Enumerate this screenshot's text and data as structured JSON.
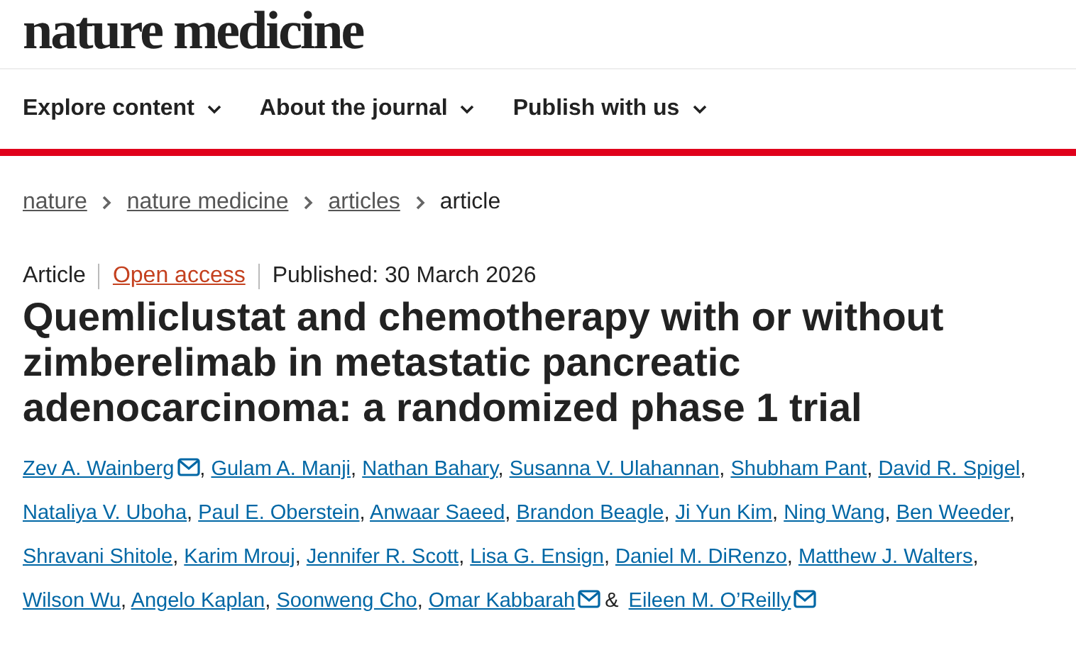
{
  "logo": "nature medicine",
  "nav": [
    {
      "label": "Explore content"
    },
    {
      "label": "About the journal"
    },
    {
      "label": "Publish with us"
    }
  ],
  "breadcrumb": [
    {
      "label": "nature",
      "current": false
    },
    {
      "label": "nature medicine",
      "current": false
    },
    {
      "label": "articles",
      "current": false
    },
    {
      "label": "article",
      "current": true
    }
  ],
  "meta": [
    {
      "text": "Article",
      "kind": "type"
    },
    {
      "text": "Open access",
      "kind": "access"
    },
    {
      "text": "Published: 30 March 2026",
      "kind": "date"
    }
  ],
  "title": "Quemliclustat and chemotherapy with or without zimberelimab in metastatic pancreatic adenocarcinoma: a randomized phase 1 trial",
  "authors": [
    {
      "name": "Zev A. Wainberg",
      "email": true,
      "sep": ","
    },
    {
      "name": "Gulam A. Manji",
      "email": false,
      "sep": ","
    },
    {
      "name": "Nathan Bahary",
      "email": false,
      "sep": ","
    },
    {
      "name": "Susanna V. Ulahannan",
      "email": false,
      "sep": ","
    },
    {
      "name": "Shubham Pant",
      "email": false,
      "sep": ","
    },
    {
      "name": "David R. Spigel",
      "email": false,
      "sep": ","
    },
    {
      "name": "Nataliya V. Uboha",
      "email": false,
      "sep": ","
    },
    {
      "name": "Paul E. Oberstein",
      "email": false,
      "sep": ","
    },
    {
      "name": "Anwaar Saeed",
      "email": false,
      "sep": ","
    },
    {
      "name": "Brandon Beagle",
      "email": false,
      "sep": ","
    },
    {
      "name": "Ji Yun Kim",
      "email": false,
      "sep": ","
    },
    {
      "name": "Ning Wang",
      "email": false,
      "sep": ","
    },
    {
      "name": "Ben Weeder",
      "email": false,
      "sep": ","
    },
    {
      "name": "Shravani Shitole",
      "email": false,
      "sep": ","
    },
    {
      "name": "Karim Mrouj",
      "email": false,
      "sep": ","
    },
    {
      "name": "Jennifer R. Scott",
      "email": false,
      "sep": ","
    },
    {
      "name": "Lisa G. Ensign",
      "email": false,
      "sep": ","
    },
    {
      "name": "Daniel M. DiRenzo",
      "email": false,
      "sep": ","
    },
    {
      "name": "Matthew J. Walters",
      "email": false,
      "sep": ","
    },
    {
      "name": "Wilson Wu",
      "email": false,
      "sep": ","
    },
    {
      "name": "Angelo Kaplan",
      "email": false,
      "sep": ","
    },
    {
      "name": "Soonweng Cho",
      "email": false,
      "sep": ","
    },
    {
      "name": "Omar Kabbarah",
      "email": true,
      "sep": "&"
    },
    {
      "name": "Eileen M. O’Reilly",
      "email": true
    }
  ]
}
